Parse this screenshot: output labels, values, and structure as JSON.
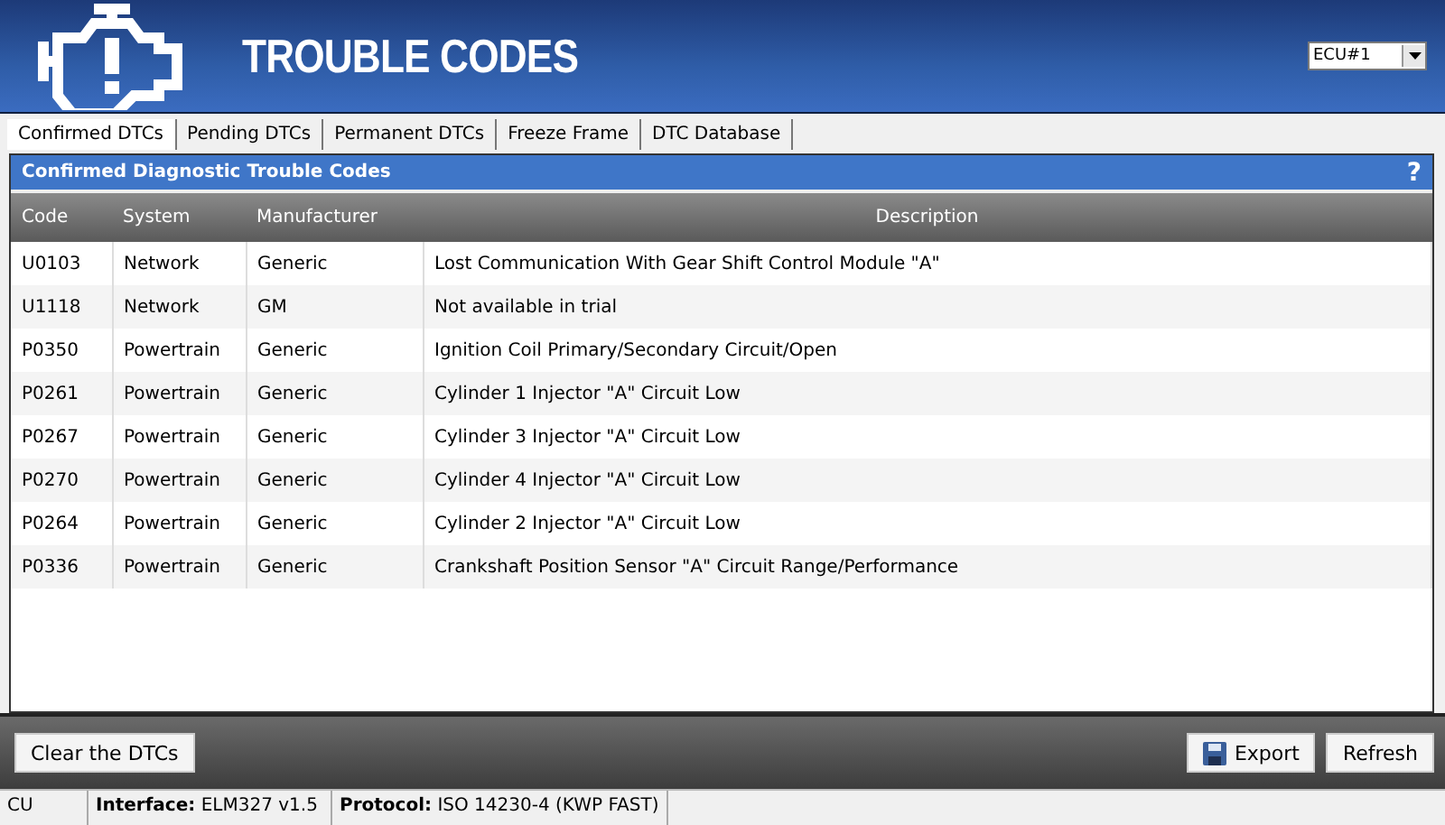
{
  "header": {
    "title": "TROUBLE CODES",
    "ecu_select": {
      "value": "ECU#1"
    }
  },
  "tabs": [
    {
      "label": "Confirmed DTCs",
      "selected": true
    },
    {
      "label": "Pending DTCs",
      "selected": false
    },
    {
      "label": "Permanent DTCs",
      "selected": false
    },
    {
      "label": "Freeze Frame",
      "selected": false
    },
    {
      "label": "DTC Database",
      "selected": false
    }
  ],
  "panel": {
    "title": "Confirmed Diagnostic Trouble Codes",
    "help": "?"
  },
  "table": {
    "columns": [
      "Code",
      "System",
      "Manufacturer",
      "Description"
    ],
    "rows": [
      [
        "U0103",
        "Network",
        "Generic",
        "Lost Communication With Gear Shift Control Module \"A\""
      ],
      [
        "U1118",
        "Network",
        "GM",
        "Not available in trial"
      ],
      [
        "P0350",
        "Powertrain",
        "Generic",
        "Ignition Coil Primary/Secondary Circuit/Open"
      ],
      [
        "P0261",
        "Powertrain",
        "Generic",
        "Cylinder 1 Injector \"A\" Circuit Low"
      ],
      [
        "P0267",
        "Powertrain",
        "Generic",
        "Cylinder 3 Injector \"A\" Circuit Low"
      ],
      [
        "P0270",
        "Powertrain",
        "Generic",
        "Cylinder 4 Injector \"A\" Circuit Low"
      ],
      [
        "P0264",
        "Powertrain",
        "Generic",
        "Cylinder 2 Injector \"A\" Circuit Low"
      ],
      [
        "P0336",
        "Powertrain",
        "Generic",
        "Crankshaft Position Sensor \"A\" Circuit Range/Performance"
      ]
    ]
  },
  "buttons": {
    "clear": "Clear the DTCs",
    "export": "Export",
    "refresh": "Refresh"
  },
  "status_bar": [
    "CU",
    "**Interface:** ELM327 v1.5",
    "**Protocol:** ISO 14230-4 (KWP FAST)"
  ]
}
